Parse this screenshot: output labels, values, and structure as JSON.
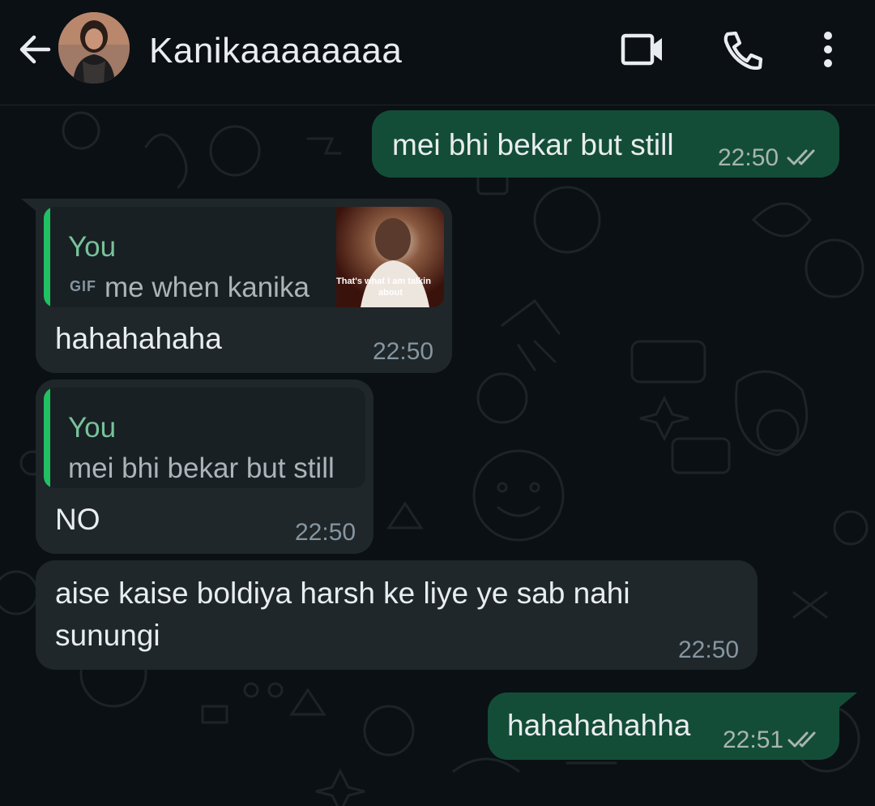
{
  "header": {
    "contact_name": "Kanikaaaaaaaa"
  },
  "messages": [
    {
      "direction": "out",
      "text": "mei bhi bekar but still",
      "time": "22:50",
      "status": "read"
    },
    {
      "direction": "in",
      "quote": {
        "author": "You",
        "media_label": "GIF",
        "text": "me when kanika",
        "thumbnail_caption_1": "That's what I am talkin",
        "thumbnail_caption_2": "about"
      },
      "text": "hahahahaha",
      "time": "22:50"
    },
    {
      "direction": "in",
      "quote": {
        "author": "You",
        "text": "mei bhi bekar but still"
      },
      "text": "NO",
      "time": "22:50"
    },
    {
      "direction": "in",
      "text_line1": "aise kaise boldiya harsh ke liye ye sab nahi",
      "text_line2": "sunungi",
      "time": "22:50"
    },
    {
      "direction": "out",
      "text": "hahahahahha",
      "time": "22:51",
      "status": "read"
    }
  ],
  "colors": {
    "background": "#0b1014",
    "outgoing_bubble": "#144d37",
    "incoming_bubble": "#1f272a",
    "quote_accent": "#21c063",
    "quote_author": "#78c29a",
    "read_ticks": "#a7b5b2"
  },
  "icons": [
    "back-arrow-icon",
    "video-call-icon",
    "phone-call-icon",
    "more-options-icon",
    "double-check-icon",
    "gif-icon"
  ]
}
